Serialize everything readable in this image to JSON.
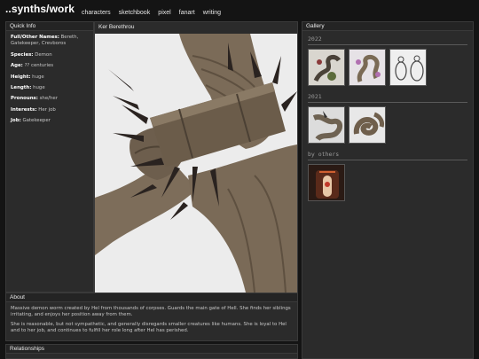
{
  "site": {
    "title": "..synths/work",
    "nav": [
      "characters",
      "sketchbook",
      "pixel",
      "fanart",
      "writing"
    ]
  },
  "quick_info": {
    "heading": "Quick Info",
    "rows": [
      {
        "label": "Full/Other Names:",
        "value": "Bereth, Gatekeeper, Crevboros"
      },
      {
        "label": "Species:",
        "value": "Demon"
      },
      {
        "label": "Age:",
        "value": "?? centuries"
      },
      {
        "label": "Height:",
        "value": "huge"
      },
      {
        "label": "Length:",
        "value": "huge"
      },
      {
        "label": "Pronouns:",
        "value": "she/her"
      },
      {
        "label": "Interests:",
        "value": "Her job"
      },
      {
        "label": "Job:",
        "value": "Gatekeeper"
      }
    ]
  },
  "viewer": {
    "title": "Ker Berethrou"
  },
  "about": {
    "heading": "About",
    "paragraphs": [
      "Massive demon worm created by Hel from thousands of corpses. Guards the main gate of Hell. She finds her siblings irritating, and enjoys her position away from them.",
      "She is reasonable, but not sympathetic, and generally disregards smaller creatures like humans. She is loyal to Hel and to her job, and continues to fulfill her role long after Hel has perished."
    ]
  },
  "relationships": {
    "heading": "Relationships"
  },
  "gallery": {
    "heading": "Gallery",
    "sections": [
      {
        "label": "2022",
        "thumbs": [
          "worm-sketch-thumb",
          "worm-purple-thumb",
          "figures-sketch-thumb"
        ]
      },
      {
        "label": "2021",
        "thumbs": [
          "worm-grey-thumb",
          "worm-coil-thumb"
        ]
      },
      {
        "label": "by others",
        "thumbs": [
          "fanart-gate-thumb"
        ]
      }
    ]
  },
  "colors": {
    "background": "#141414",
    "panel": "#2b2b2b",
    "worm": "#7a6a58"
  }
}
